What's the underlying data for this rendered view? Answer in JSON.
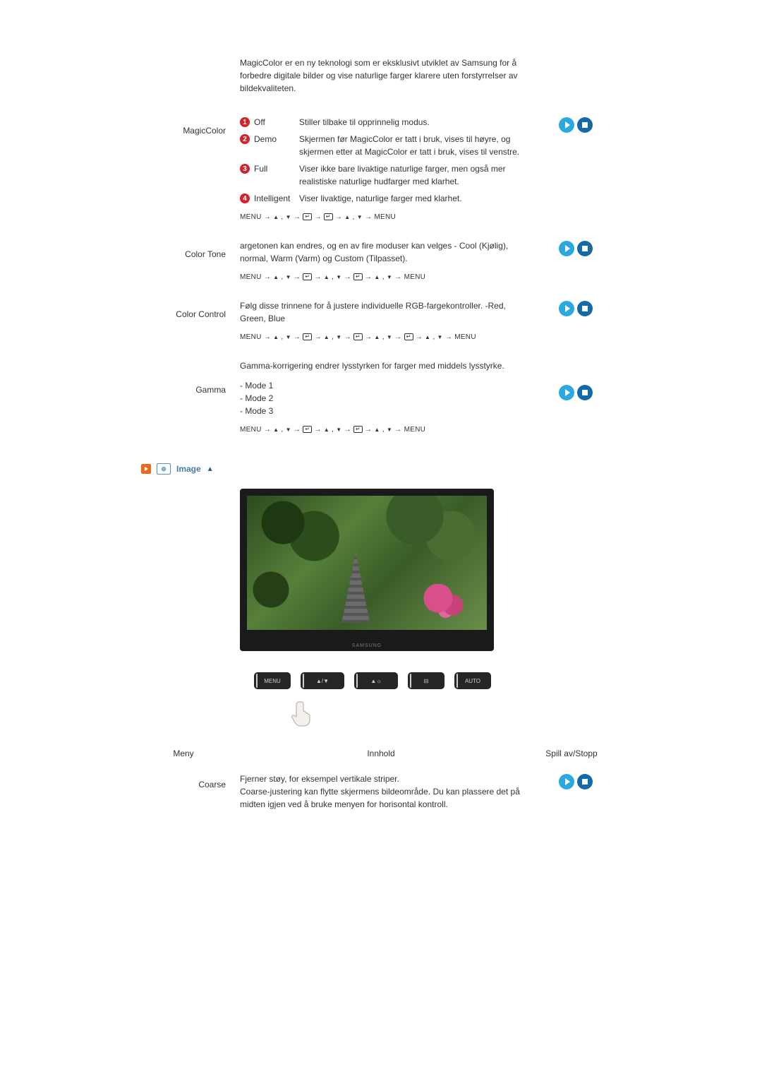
{
  "intro": "MagicColor er en ny teknologi som er eksklusivt utviklet av Samsung for å forbedre digitale bilder og vise naturlige farger klarere uten forstyrrelser av bildekvaliteten.",
  "magiccolor": {
    "label": "MagicColor",
    "options": [
      {
        "badge": "1",
        "name": "Off",
        "desc": "Stiller tilbake til opprinnelig modus."
      },
      {
        "badge": "2",
        "name": "Demo",
        "desc": "Skjermen før MagicColor er tatt i bruk, vises til høyre, og skjermen etter at MagicColor er tatt i bruk, vises til venstre."
      },
      {
        "badge": "3",
        "name": "Full",
        "desc": "Viser ikke bare livaktige naturlige farger, men også mer realistiske naturlige hudfarger med klarhet."
      },
      {
        "badge": "4",
        "name": "Intelligent",
        "desc": "Viser livaktige, naturlige farger med klarhet."
      }
    ],
    "nav": {
      "type": "seq1"
    }
  },
  "colortone": {
    "label": "Color Tone",
    "desc": "argetonen kan endres, og en av fire moduser kan velges - Cool (Kjølig), normal, Warm (Varm) og Custom (Tilpasset).",
    "nav": {
      "type": "seq2"
    }
  },
  "colorcontrol": {
    "label": "Color Control",
    "desc": "Følg disse trinnene for å justere individuelle RGB-fargekontroller. -Red, Green, Blue",
    "nav": {
      "type": "seq3"
    }
  },
  "gamma": {
    "label": "Gamma",
    "desc": "Gamma-korrigering endrer lysstyrken for farger med middels lysstyrke.",
    "modes": [
      "- Mode 1",
      "- Mode 2",
      "- Mode 3"
    ],
    "nav": {
      "type": "seq2"
    }
  },
  "section_image": {
    "label": "Image",
    "icon2_text": "⊕"
  },
  "osd": {
    "buttons": [
      "MENU",
      "▲/▼",
      "▲☼",
      "⊟",
      "AUTO"
    ]
  },
  "headers": {
    "menu": "Meny",
    "content": "Innhold",
    "playstop": "Spill av/Stopp"
  },
  "coarse": {
    "label": "Coarse",
    "desc": "Fjerner støy, for eksempel vertikale striper.\nCoarse-justering kan flytte skjermens bildeområde. Du kan plassere det på midten igjen ved å bruke menyen for horisontal kontroll."
  },
  "monitor_brand": "SAMSUNG"
}
